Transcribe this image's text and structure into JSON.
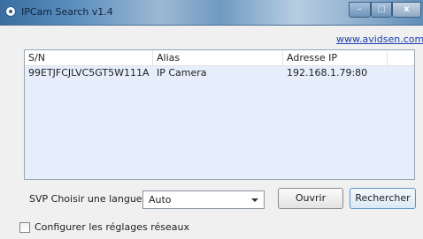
{
  "window": {
    "title": "IPCam Search  v1.4",
    "minimize_glyph": "–",
    "maximize_glyph": "□",
    "close_glyph": "x"
  },
  "link": {
    "text": "www.avidsen.com"
  },
  "table": {
    "columns": [
      "S/N",
      "Alias",
      "Adresse IP",
      ""
    ],
    "rows": [
      [
        "99ETJFCJLVC5GT5W111A",
        "IP Camera",
        "192.168.1.79:80"
      ]
    ]
  },
  "language": {
    "label": "SVP Choisir une langue",
    "selected": "Auto"
  },
  "buttons": {
    "open": "Ouvrir",
    "search": "Rechercher"
  },
  "network_settings": {
    "label": "Configurer les réglages réseaux",
    "checked": false
  },
  "icons": {
    "app": "camera-app-icon",
    "dropdown": "chevron-down-icon"
  },
  "colors": {
    "link": "#1a3fb0",
    "list_row_bg": "#e6eefb",
    "focus_button_border": "#5f93c8"
  }
}
